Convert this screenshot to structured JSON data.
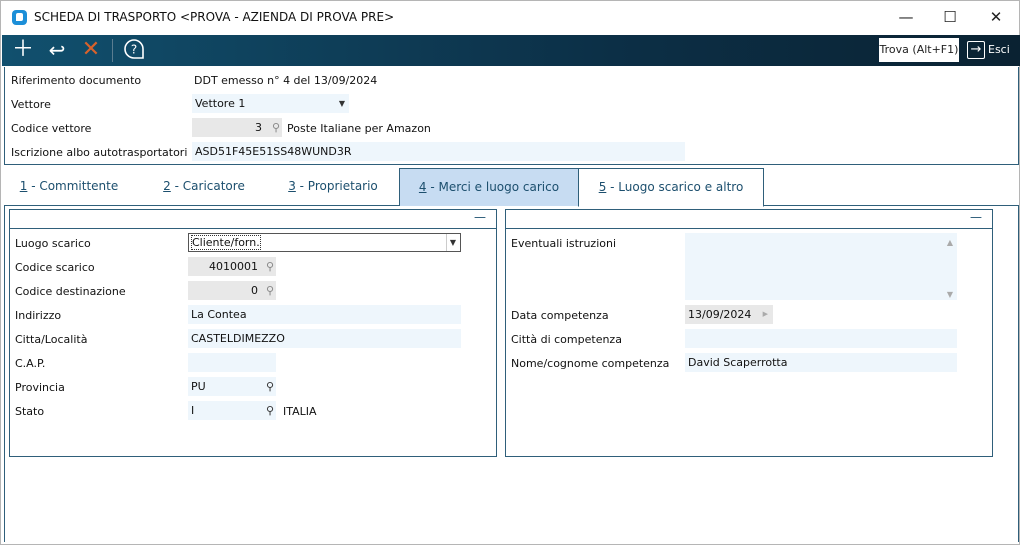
{
  "window": {
    "title": "SCHEDA DI TRASPORTO <PROVA - AZIENDA DI PROVA PRE>",
    "minimize": "—",
    "maximize": "☐",
    "close": "✕"
  },
  "toolbar": {
    "add_icon": "plus-icon",
    "undo_icon": "undo-icon",
    "delete_icon": "x-icon",
    "help_icon": "help-icon",
    "find_label": "Trova (Alt+F1)",
    "exit_label": "Esci"
  },
  "colors": {
    "toolbar": "#11506e",
    "accent": "#1c4f6e",
    "delete": "#d9622b",
    "active_tab": "#c7dcf2",
    "field": "#eef6fc"
  },
  "header": {
    "riferimento": {
      "label": "Riferimento documento",
      "value": "DDT emesso n° 4 del 13/09/2024"
    },
    "vettore": {
      "label": "Vettore",
      "value": "Vettore 1"
    },
    "codice_vettore": {
      "label": "Codice vettore",
      "value": "3",
      "description": "Poste Italiane per Amazon"
    },
    "iscrizione": {
      "label": "Iscrizione albo autotrasportatori",
      "value": "ASD51F45E51SS48WUND3R"
    }
  },
  "tabs": [
    {
      "num": "1",
      "label": " - Committente"
    },
    {
      "num": "2",
      "label": " - Caricatore"
    },
    {
      "num": "3",
      "label": " - Proprietario"
    },
    {
      "num": "4",
      "label": " - Merci e luogo carico"
    },
    {
      "num": "5",
      "label": " - Luogo scarico e altro"
    }
  ],
  "left": {
    "collapse": "—",
    "luogo_scarico": {
      "label": "Luogo scarico",
      "value": "Cliente/forn."
    },
    "codice_scarico": {
      "label": "Codice scarico",
      "value": "4010001"
    },
    "codice_destinazione": {
      "label": "Codice destinazione",
      "value": "0"
    },
    "indirizzo": {
      "label": "Indirizzo",
      "value": "La Contea"
    },
    "citta": {
      "label": "Citta/Località",
      "value": "CASTELDIMEZZO"
    },
    "cap": {
      "label": "C.A.P.",
      "value": ""
    },
    "provincia": {
      "label": "Provincia",
      "value": "PU"
    },
    "stato": {
      "label": "Stato",
      "value": "I",
      "description": "ITALIA"
    }
  },
  "right": {
    "collapse": "—",
    "istruzioni": {
      "label": "Eventuali istruzioni",
      "value": ""
    },
    "data_competenza": {
      "label": "Data competenza",
      "value": "13/09/2024"
    },
    "citta_competenza": {
      "label": "Città di competenza",
      "value": ""
    },
    "nome_competenza": {
      "label": "Nome/cognome competenza",
      "value": "David Scaperrotta"
    }
  }
}
